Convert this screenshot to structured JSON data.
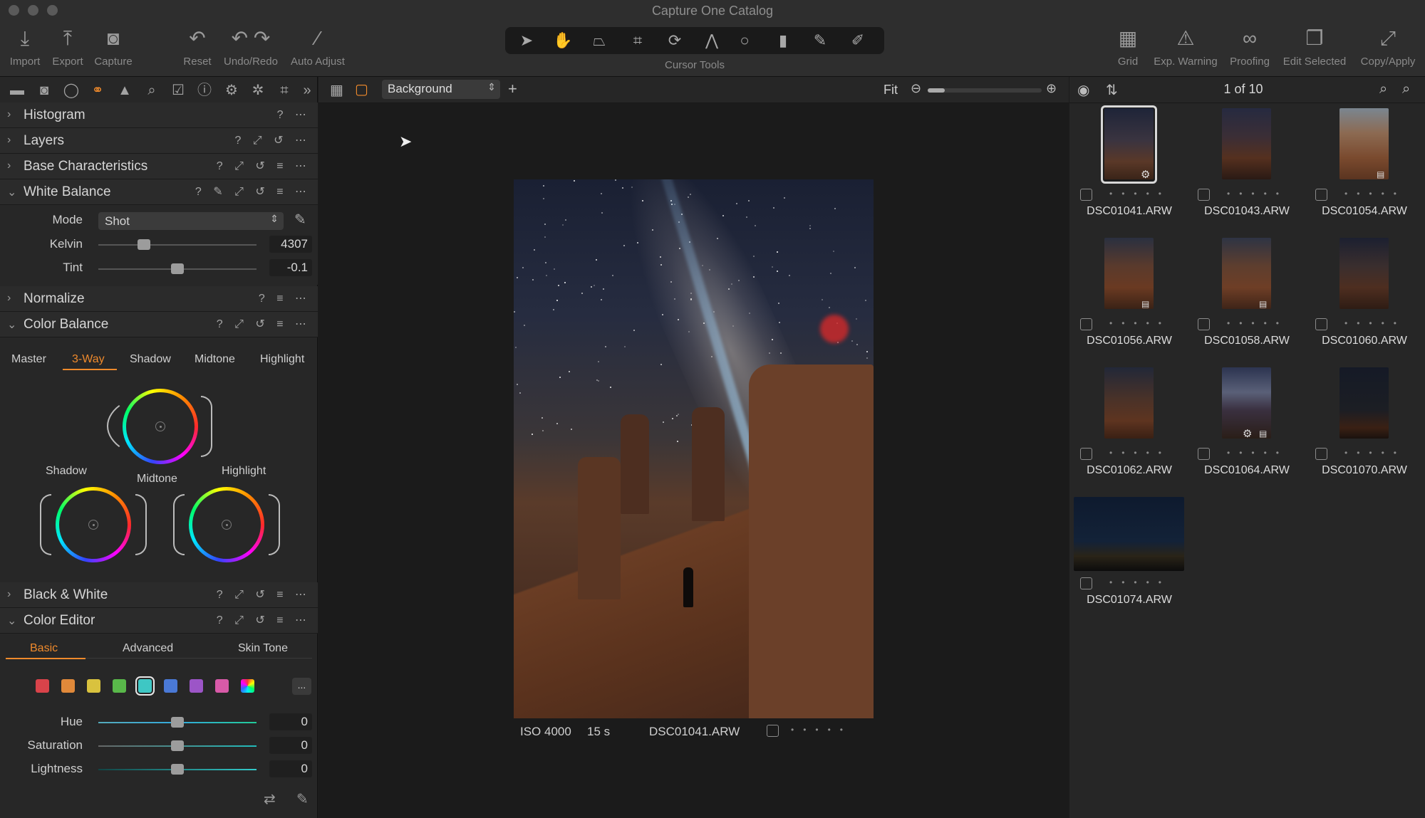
{
  "window": {
    "title": "Capture One Catalog"
  },
  "toolbar": {
    "import": "Import",
    "export": "Export",
    "capture": "Capture",
    "reset": "Reset",
    "undo_redo": "Undo/Redo",
    "auto_adjust": "Auto Adjust",
    "cursor_tools": "Cursor Tools",
    "grid": "Grid",
    "exp_warning": "Exp. Warning",
    "proofing": "Proofing",
    "edit_selected": "Edit Selected",
    "copy_apply": "Copy/Apply"
  },
  "left_panel": {
    "sections": {
      "histogram": "Histogram",
      "layers": "Layers",
      "base_characteristics": "Base Characteristics",
      "white_balance": "White Balance",
      "normalize": "Normalize",
      "color_balance": "Color Balance",
      "black_white": "Black & White",
      "color_editor": "Color Editor"
    },
    "white_balance": {
      "mode_label": "Mode",
      "mode_value": "Shot",
      "kelvin_label": "Kelvin",
      "kelvin_value": "4307",
      "kelvin_level": 0.29,
      "tint_label": "Tint",
      "tint_value": "-0.1",
      "tint_level": 0.5
    },
    "color_balance": {
      "tabs": [
        "Master",
        "3-Way",
        "Shadow",
        "Midtone",
        "Highlight"
      ],
      "active_tab": "3-Way",
      "wheel_labels": {
        "shadow": "Shadow",
        "midtone": "Midtone",
        "highlight": "Highlight"
      }
    },
    "color_editor": {
      "tabs": [
        "Basic",
        "Advanced",
        "Skin Tone"
      ],
      "active_tab": "Basic",
      "swatches": [
        "#d9434a",
        "#e0893a",
        "#d9c23e",
        "#59b84a",
        "#3ec7c4",
        "#4a79d6",
        "#9c55c7",
        "#d85aa8"
      ],
      "selected_swatch": 4,
      "more_label": "...",
      "hue_label": "Hue",
      "hue_value": "0",
      "saturation_label": "Saturation",
      "saturation_value": "0",
      "lightness_label": "Lightness",
      "lightness_value": "0"
    }
  },
  "viewer": {
    "variant": "Background",
    "zoom_label": "Fit",
    "zoom_level": 0.15,
    "iso": "ISO 4000",
    "shutter": "15 s",
    "filename": "DSC01041.ARW"
  },
  "browser": {
    "counter": "1 of 10",
    "thumbnails": [
      {
        "name": "DSC01041.ARW",
        "selected": true
      },
      {
        "name": "DSC01043.ARW"
      },
      {
        "name": "DSC01054.ARW"
      },
      {
        "name": "DSC01056.ARW"
      },
      {
        "name": "DSC01058.ARW"
      },
      {
        "name": "DSC01060.ARW"
      },
      {
        "name": "DSC01062.ARW"
      },
      {
        "name": "DSC01064.ARW"
      },
      {
        "name": "DSC01070.ARW"
      },
      {
        "name": "DSC01074.ARW"
      }
    ]
  },
  "colors": {
    "accent": "#ef8a2c",
    "panel": "#272727",
    "viewer": "#1b1b1b"
  }
}
